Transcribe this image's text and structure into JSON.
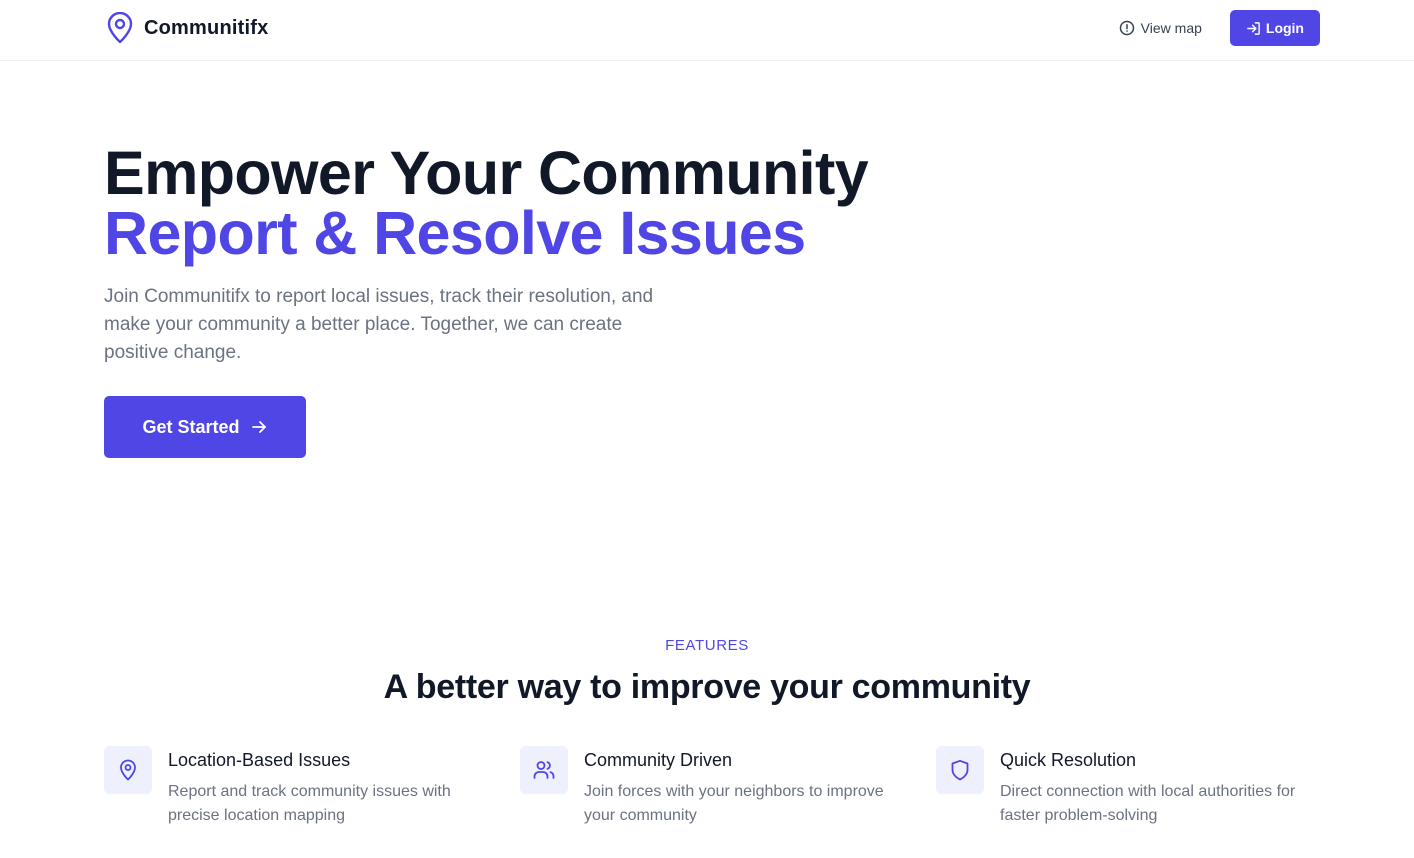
{
  "nav": {
    "brand": "Communitifx",
    "view_map": "View map",
    "login": "Login",
    "brand_icon": "map-pin-icon",
    "view_map_icon": "alert-circle-icon",
    "login_icon": "log-in-icon"
  },
  "hero": {
    "title_line1": "Empower Your Community",
    "title_line2": "Report & Resolve Issues",
    "description": "Join Communitifx to report local issues, track their resolution, and make your community a better place. Together, we can create positive change.",
    "cta": "Get Started",
    "cta_icon": "arrow-right-icon"
  },
  "features": {
    "eyebrow": "FEATURES",
    "title": "A better way to improve your community",
    "items": [
      {
        "icon": "map-pin-icon",
        "title": "Location-Based Issues",
        "description": "Report and track community issues with precise location mapping"
      },
      {
        "icon": "users-icon",
        "title": "Community Driven",
        "description": "Join forces with your neighbors to improve your community"
      },
      {
        "icon": "shield-icon",
        "title": "Quick Resolution",
        "description": "Direct connection with local authorities for faster problem-solving"
      }
    ]
  },
  "colors": {
    "accent": "#4f46e5",
    "heading": "#111827",
    "muted": "#6b7280",
    "icon_bg": "#eef0fd"
  }
}
